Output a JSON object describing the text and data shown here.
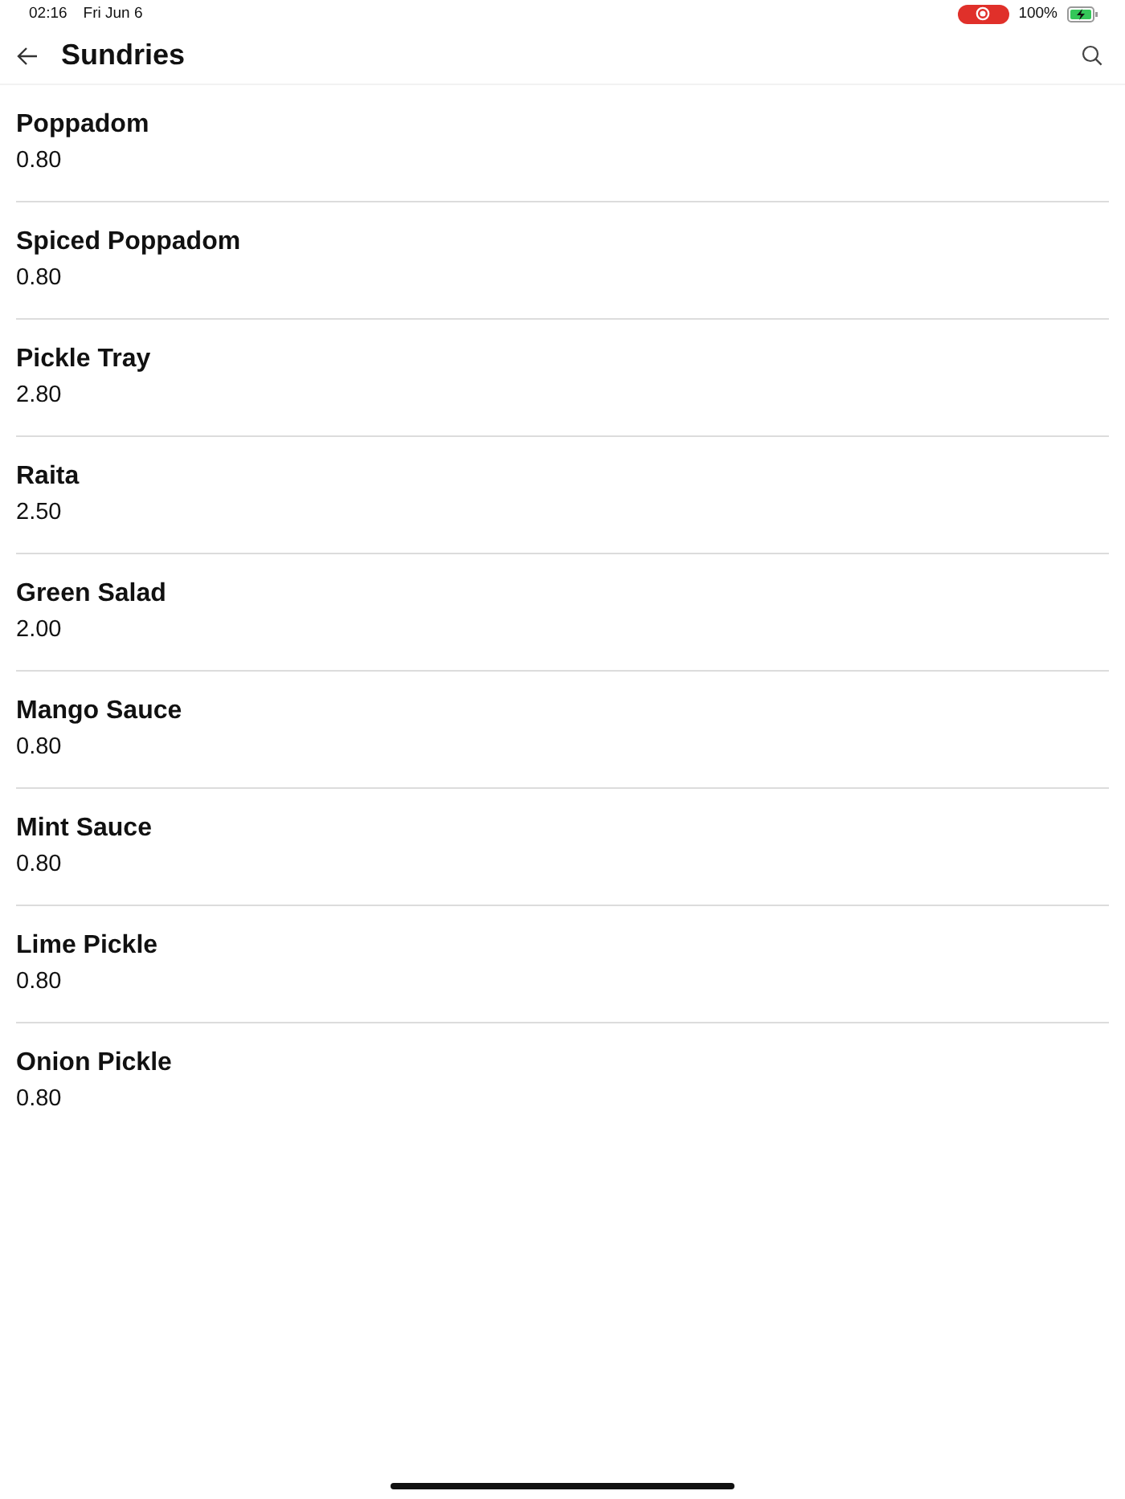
{
  "status_bar": {
    "time": "02:16",
    "date": "Fri Jun 6",
    "battery": "100%"
  },
  "header": {
    "title": "Sundries"
  },
  "items": [
    {
      "name": "Poppadom",
      "price": "0.80"
    },
    {
      "name": "Spiced Poppadom",
      "price": "0.80"
    },
    {
      "name": "Pickle Tray",
      "price": "2.80"
    },
    {
      "name": "Raita",
      "price": "2.50"
    },
    {
      "name": "Green Salad",
      "price": "2.00"
    },
    {
      "name": "Mango Sauce",
      "price": "0.80"
    },
    {
      "name": "Mint Sauce",
      "price": "0.80"
    },
    {
      "name": "Lime Pickle",
      "price": "0.80"
    },
    {
      "name": "Onion Pickle",
      "price": "0.80"
    }
  ]
}
